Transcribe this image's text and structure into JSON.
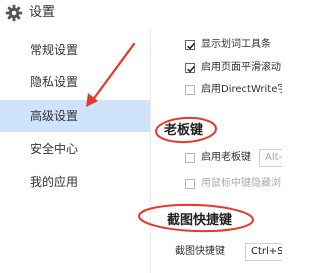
{
  "window": {
    "title": "设置",
    "icon": "gear-icon"
  },
  "sidebar": {
    "items": [
      {
        "label": "常规设置",
        "active": false
      },
      {
        "label": "隐私设置",
        "active": false
      },
      {
        "label": "高级设置",
        "active": true
      },
      {
        "label": "安全中心",
        "active": false
      },
      {
        "label": "我的应用",
        "active": false
      }
    ]
  },
  "content": {
    "options": [
      {
        "label": "显示划词工具条",
        "checked": true
      },
      {
        "label": "启用页面平滑滚动",
        "checked": true
      },
      {
        "label": "启用DirectWrite字",
        "checked": false
      }
    ],
    "boss_key": {
      "title": "老板键",
      "enable_label": "启用老板键",
      "enable_checked": false,
      "hotkey_value": "Alt-",
      "middle_click_label": "用鼠标中键隐藏浏",
      "middle_click_checked": false
    },
    "screenshot_key": {
      "title": "截图快捷键",
      "hotkey_label": "截图快捷键",
      "hotkey_value": "Ctrl+Sh"
    }
  },
  "annotation": {
    "color": "#e8382b"
  }
}
